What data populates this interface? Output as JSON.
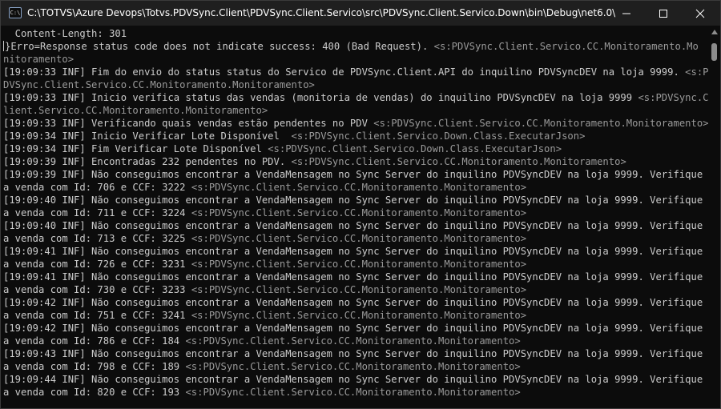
{
  "window": {
    "title": "C:\\TOTVS\\Azure Devops\\Totvs.PDVSync.Client\\PDVSync.Client.Servico\\src\\PDVSync.Client.Servico.Down\\bin\\Debug\\net6.0\\PDVSync.Clie...",
    "app_icon_glyph": "C:\\",
    "icons": {
      "minimize": "minimize-icon",
      "maximize": "maximize-icon",
      "close": "close-icon"
    }
  },
  "console": {
    "text_color": "#cccccc",
    "source_color": "#9a9a9a",
    "background": "#0c0c0c",
    "lines": [
      {
        "text": "  Content-Length: 301",
        "src": ""
      },
      {
        "text": "}Erro=Response status code does not indicate success: 400 (Bad Request). ",
        "src": "<s:PDVSync.Client.Servico.CC.Monitoramento.Mo",
        "cursor": true
      },
      {
        "text": "",
        "src": "nitoramento>"
      },
      {
        "text": "[19:09:33 INF] Fim do envio do status status do Servico de PDVSync.Client.API do inquilino PDVSyncDEV na loja 9999. ",
        "src": "<s:P"
      },
      {
        "text": "",
        "src": "DVSync.Client.Servico.CC.Monitoramento.Monitoramento>"
      },
      {
        "text": "[19:09:33 INF] Inicio verifica status das vendas (monitoria de vendas) do inquilino PDVSyncDEV na loja 9999 ",
        "src": "<s:PDVSync.C"
      },
      {
        "text": "",
        "src": "lient.Servico.CC.Monitoramento.Monitoramento>"
      },
      {
        "text": "[19:09:33 INF] Verificando quais vendas estão pendentes no PDV ",
        "src": "<s:PDVSync.Client.Servico.CC.Monitoramento.Monitoramento>"
      },
      {
        "text": "[19:09:34 INF] Inicio Verificar Lote Disponível  ",
        "src": "<s:PDVSync.Client.Servico.Down.Class.ExecutarJson>"
      },
      {
        "text": "[19:09:34 INF] Fim Verificar Lote Disponível ",
        "src": "<s:PDVSync.Client.Servico.Down.Class.ExecutarJson>"
      },
      {
        "text": "[19:09:39 INF] Encontradas 232 pendentes no PDV. ",
        "src": "<s:PDVSync.Client.Servico.CC.Monitoramento.Monitoramento>"
      },
      {
        "text": "[19:09:39 INF] Não conseguimos encontrar a VendaMensagem no Sync Server do inquilino PDVSyncDEV na loja 9999. Verifique",
        "src": ""
      },
      {
        "text": "a venda com Id: 706 e CCF: 3222 ",
        "src": "<s:PDVSync.Client.Servico.CC.Monitoramento.Monitoramento>"
      },
      {
        "text": "[19:09:40 INF] Não conseguimos encontrar a VendaMensagem no Sync Server do inquilino PDVSyncDEV na loja 9999. Verifique",
        "src": ""
      },
      {
        "text": "a venda com Id: 711 e CCF: 3224 ",
        "src": "<s:PDVSync.Client.Servico.CC.Monitoramento.Monitoramento>"
      },
      {
        "text": "[19:09:40 INF] Não conseguimos encontrar a VendaMensagem no Sync Server do inquilino PDVSyncDEV na loja 9999. Verifique",
        "src": ""
      },
      {
        "text": "a venda com Id: 713 e CCF: 3225 ",
        "src": "<s:PDVSync.Client.Servico.CC.Monitoramento.Monitoramento>"
      },
      {
        "text": "[19:09:41 INF] Não conseguimos encontrar a VendaMensagem no Sync Server do inquilino PDVSyncDEV na loja 9999. Verifique",
        "src": ""
      },
      {
        "text": "a venda com Id: 726 e CCF: 3231 ",
        "src": "<s:PDVSync.Client.Servico.CC.Monitoramento.Monitoramento>"
      },
      {
        "text": "[19:09:41 INF] Não conseguimos encontrar a VendaMensagem no Sync Server do inquilino PDVSyncDEV na loja 9999. Verifique",
        "src": ""
      },
      {
        "text": "a venda com Id: 730 e CCF: 3233 ",
        "src": "<s:PDVSync.Client.Servico.CC.Monitoramento.Monitoramento>"
      },
      {
        "text": "[19:09:42 INF] Não conseguimos encontrar a VendaMensagem no Sync Server do inquilino PDVSyncDEV na loja 9999. Verifique",
        "src": ""
      },
      {
        "text": "a venda com Id: 751 e CCF: 3241 ",
        "src": "<s:PDVSync.Client.Servico.CC.Monitoramento.Monitoramento>"
      },
      {
        "text": "[19:09:42 INF] Não conseguimos encontrar a VendaMensagem no Sync Server do inquilino PDVSyncDEV na loja 9999. Verifique",
        "src": ""
      },
      {
        "text": "a venda com Id: 786 e CCF: 184 ",
        "src": "<s:PDVSync.Client.Servico.CC.Monitoramento.Monitoramento>"
      },
      {
        "text": "[19:09:43 INF] Não conseguimos encontrar a VendaMensagem no Sync Server do inquilino PDVSyncDEV na loja 9999. Verifique",
        "src": ""
      },
      {
        "text": "a venda com Id: 798 e CCF: 189 ",
        "src": "<s:PDVSync.Client.Servico.CC.Monitoramento.Monitoramento>"
      },
      {
        "text": "[19:09:44 INF] Não conseguimos encontrar a VendaMensagem no Sync Server do inquilino PDVSyncDEV na loja 9999. Verifique",
        "src": ""
      },
      {
        "text": "a venda com Id: 820 e CCF: 193 ",
        "src": "<s:PDVSync.Client.Servico.CC.Monitoramento.Monitoramento>"
      }
    ]
  }
}
